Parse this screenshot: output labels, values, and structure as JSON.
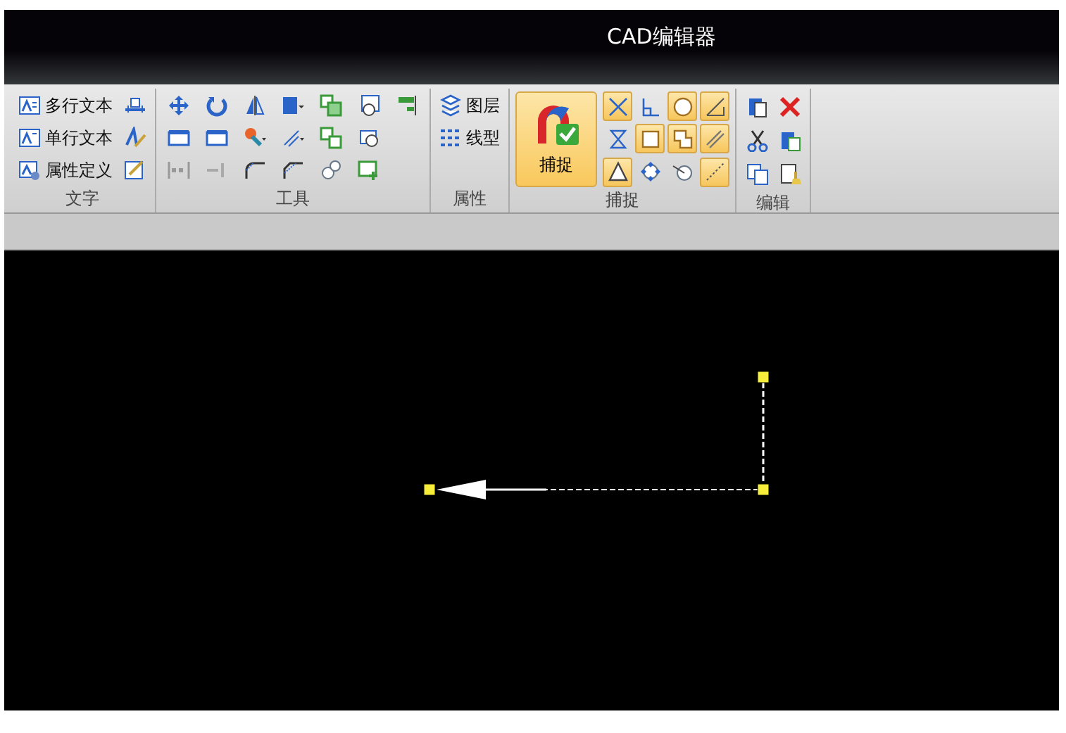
{
  "window": {
    "title": "CAD编辑器"
  },
  "ribbon": {
    "groups": [
      {
        "kind": "text",
        "label": "文字",
        "items": [
          {
            "label": "多行文本"
          },
          {
            "label": "单行文本"
          },
          {
            "label": "属性定义"
          }
        ]
      },
      {
        "kind": "tools",
        "label": "工具"
      },
      {
        "kind": "properties",
        "label": "属性",
        "items": [
          {
            "label": "图层"
          },
          {
            "label": "线型"
          }
        ]
      },
      {
        "kind": "snap",
        "label": "捕捉",
        "main": {
          "label": "捕捉",
          "on": true
        },
        "toggles": [
          {
            "on": true
          },
          {
            "on": false
          },
          {
            "on": true
          },
          {
            "on": true
          },
          {
            "on": false
          },
          {
            "on": true
          },
          {
            "on": true
          },
          {
            "on": true
          },
          {
            "on": true
          },
          {
            "on": false
          },
          {
            "on": false
          },
          {
            "on": true
          }
        ]
      },
      {
        "kind": "edit",
        "label": "编辑"
      }
    ]
  }
}
